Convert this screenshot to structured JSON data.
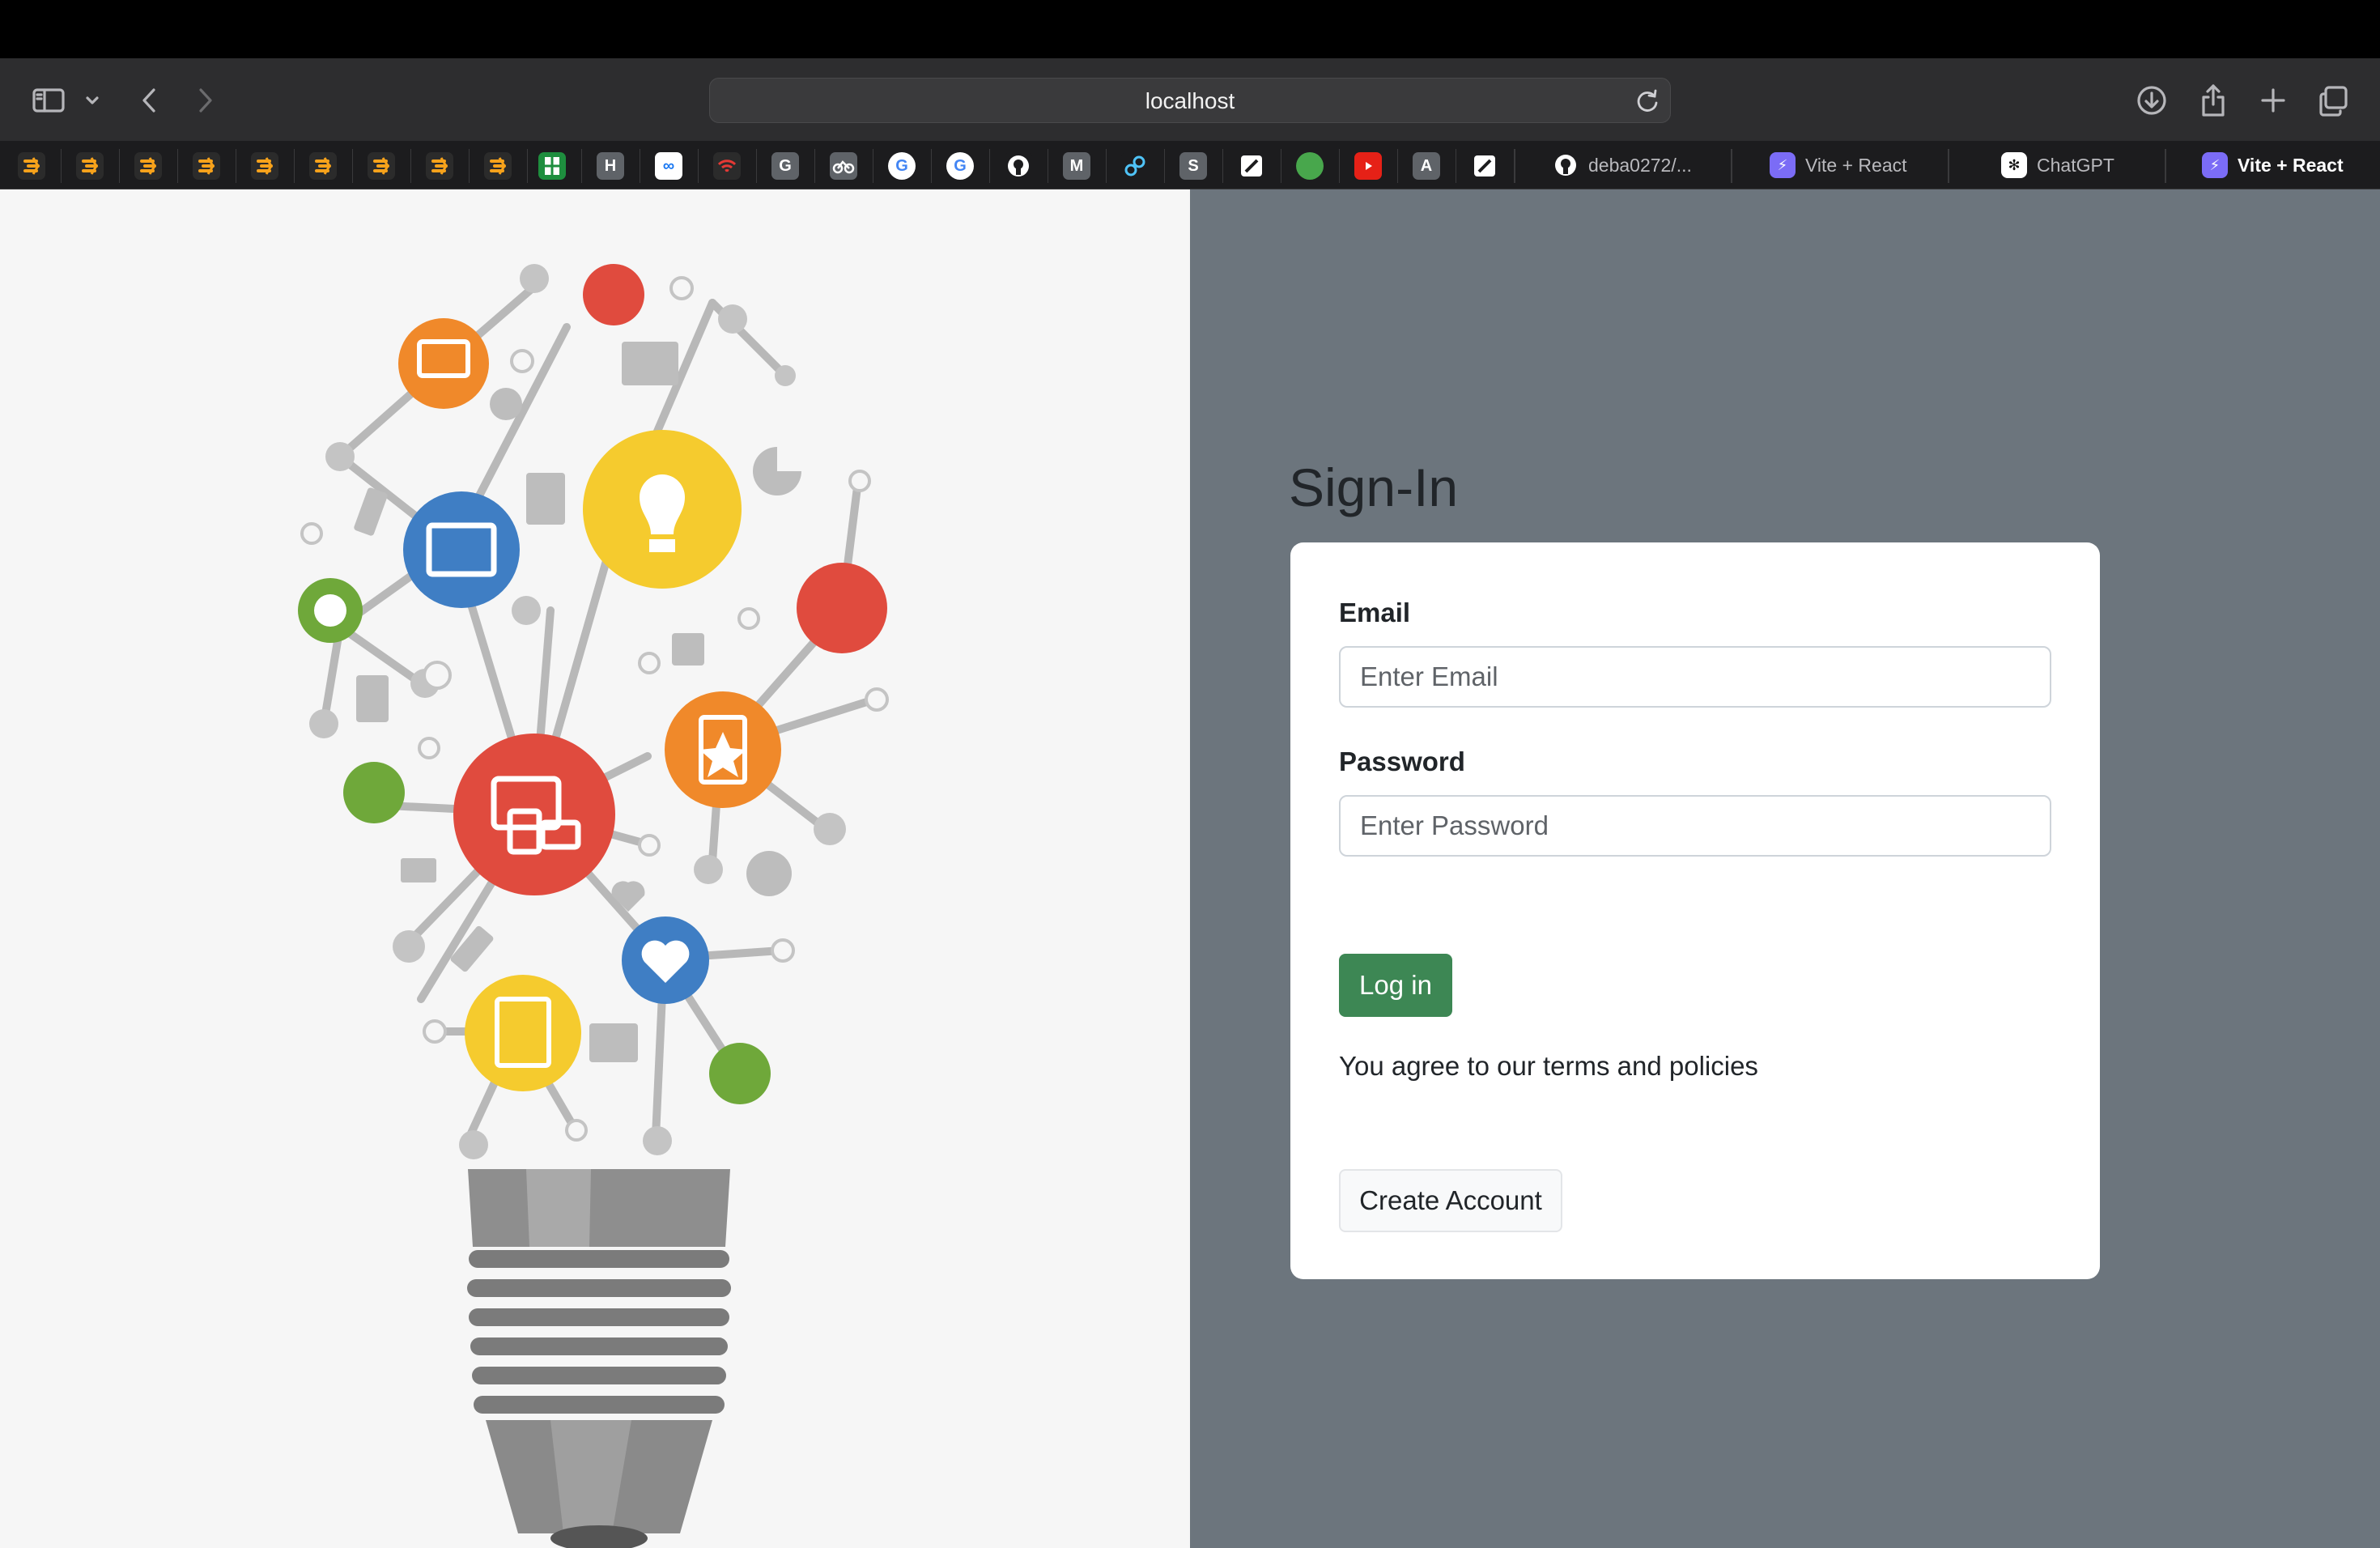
{
  "browser": {
    "address": "localhost",
    "favorites": [
      {
        "icon": "bookmark-arrow-icon",
        "label": "",
        "color": "#2b2b2b"
      },
      {
        "icon": "bookmark-arrow-icon",
        "label": "",
        "color": "#2b2b2b"
      },
      {
        "icon": "bookmark-arrow-icon",
        "label": "",
        "color": "#2b2b2b"
      },
      {
        "icon": "bookmark-arrow-icon",
        "label": "",
        "color": "#2b2b2b"
      },
      {
        "icon": "bookmark-arrow-icon",
        "label": "",
        "color": "#2b2b2b"
      },
      {
        "icon": "bookmark-arrow-icon",
        "label": "",
        "color": "#2b2b2b"
      },
      {
        "icon": "bookmark-arrow-icon",
        "label": "",
        "color": "#2b2b2b"
      },
      {
        "icon": "bookmark-arrow-icon",
        "label": "",
        "color": "#2b2b2b"
      },
      {
        "icon": "bookmark-arrow-icon",
        "label": "",
        "color": "#2b2b2b"
      },
      {
        "icon": "sheets-icon",
        "label": "",
        "color": "#1e8e3e"
      },
      {
        "icon": "h-icon",
        "label": "H",
        "color": "#5f6368"
      },
      {
        "icon": "meta-icon",
        "label": "∞",
        "color": "#1877f2"
      },
      {
        "icon": "wifi-icon",
        "label": "",
        "color": "#2b2b2b"
      },
      {
        "icon": "g-icon",
        "label": "G",
        "color": "#5f6368"
      },
      {
        "icon": "bike-icon",
        "label": "",
        "color": "#5f6368"
      },
      {
        "icon": "google-icon",
        "label": "G",
        "color": "#ffffff"
      },
      {
        "icon": "google-icon",
        "label": "G",
        "color": "#ffffff"
      },
      {
        "icon": "github-icon",
        "label": "",
        "color": "#1c1c1e"
      },
      {
        "icon": "m-icon",
        "label": "M",
        "color": "#5f6368"
      },
      {
        "icon": "link-icon",
        "label": "",
        "color": "#1c1c1e"
      },
      {
        "icon": "s-icon",
        "label": "S",
        "color": "#5f6368"
      },
      {
        "icon": "pen-icon",
        "label": "",
        "color": "#1c1c1e"
      },
      {
        "icon": "grammarly-icon",
        "label": "",
        "color": "#48a74c"
      },
      {
        "icon": "youtube-icon",
        "label": "",
        "color": "#e62117"
      },
      {
        "icon": "a-icon",
        "label": "A",
        "color": "#5f6368"
      },
      {
        "icon": "pen-icon",
        "label": "",
        "color": "#1c1c1e"
      }
    ],
    "tabs": [
      {
        "label": "deba0272/...",
        "icon": "github-icon",
        "active": false
      },
      {
        "label": "Vite + React",
        "icon": "vite-icon",
        "active": false
      },
      {
        "label": "ChatGPT",
        "icon": "chatgpt-icon",
        "active": false
      },
      {
        "label": "Vite + React",
        "icon": "vite-icon",
        "active": true
      }
    ]
  },
  "page": {
    "title": "Sign-In",
    "email_label": "Email",
    "email_placeholder": "Enter Email",
    "email_value": "",
    "password_label": "Password",
    "password_placeholder": "Enter Password",
    "password_value": "",
    "login_label": "Log in",
    "terms": "You agree to our terms and policies",
    "create_label": "Create Account"
  },
  "colors": {
    "right_bg": "#6c757d",
    "login_btn": "#3d8754",
    "left_bg": "#f6f6f6"
  }
}
